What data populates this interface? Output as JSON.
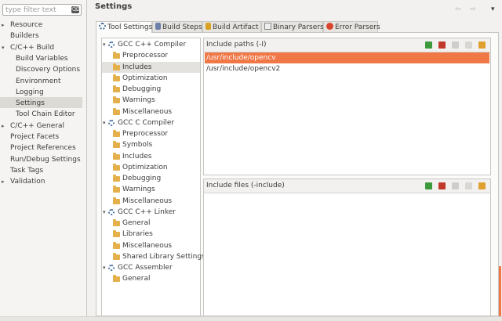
{
  "filter": {
    "placeholder": "type filter text",
    "clear_glyph": "⌫"
  },
  "nav": {
    "items": [
      {
        "label": "Resource",
        "expander": "▸"
      },
      {
        "label": "Builders",
        "expander": ""
      },
      {
        "label": "C/C++ Build",
        "expander": "▾"
      },
      {
        "label": "Build Variables",
        "expander": ""
      },
      {
        "label": "Discovery Options",
        "expander": ""
      },
      {
        "label": "Environment",
        "expander": ""
      },
      {
        "label": "Logging",
        "expander": ""
      },
      {
        "label": "Settings",
        "expander": ""
      },
      {
        "label": "Tool Chain Editor",
        "expander": ""
      },
      {
        "label": "C/C++ General",
        "expander": "▸"
      },
      {
        "label": "Project Facets",
        "expander": ""
      },
      {
        "label": "Project References",
        "expander": ""
      },
      {
        "label": "Run/Debug Settings",
        "expander": ""
      },
      {
        "label": "Task Tags",
        "expander": ""
      },
      {
        "label": "Validation",
        "expander": "▸"
      }
    ],
    "selected": "Settings"
  },
  "page": {
    "title": "Settings",
    "history": {
      "back": "⇦",
      "forward": "⇨",
      "menu": "▾"
    }
  },
  "tabs": [
    {
      "label": "Tool Settings",
      "icon": "gear-icon",
      "active": true
    },
    {
      "label": "Build Steps",
      "icon": "wrench-icon",
      "active": false
    },
    {
      "label": "Build Artifact",
      "icon": "trophy-icon",
      "active": false
    },
    {
      "label": "Binary Parsers",
      "icon": "binary-icon",
      "active": false
    },
    {
      "label": "Error Parsers",
      "icon": "error-icon",
      "active": false
    }
  ],
  "tool_tree": [
    {
      "label": "GCC C++ Compiler",
      "type": "tool",
      "expander": "▾"
    },
    {
      "label": "Preprocessor",
      "type": "option"
    },
    {
      "label": "Includes",
      "type": "option"
    },
    {
      "label": "Optimization",
      "type": "option"
    },
    {
      "label": "Debugging",
      "type": "option"
    },
    {
      "label": "Warnings",
      "type": "option"
    },
    {
      "label": "Miscellaneous",
      "type": "option"
    },
    {
      "label": "GCC C Compiler",
      "type": "tool",
      "expander": "▾"
    },
    {
      "label": "Preprocessor",
      "type": "option"
    },
    {
      "label": "Symbols",
      "type": "option"
    },
    {
      "label": "Includes",
      "type": "option"
    },
    {
      "label": "Optimization",
      "type": "option"
    },
    {
      "label": "Debugging",
      "type": "option"
    },
    {
      "label": "Warnings",
      "type": "option"
    },
    {
      "label": "Miscellaneous",
      "type": "option"
    },
    {
      "label": "GCC C++ Linker",
      "type": "tool",
      "expander": "▾"
    },
    {
      "label": "General",
      "type": "option"
    },
    {
      "label": "Libraries",
      "type": "option"
    },
    {
      "label": "Miscellaneous",
      "type": "option"
    },
    {
      "label": "Shared Library Settings",
      "type": "option"
    },
    {
      "label": "GCC Assembler",
      "type": "tool",
      "expander": "▾"
    },
    {
      "label": "General",
      "type": "option"
    }
  ],
  "include_paths": {
    "title": "Include paths (-I)",
    "items": [
      "/usr/include/opencv",
      "/usr/include/opencv2"
    ],
    "selected_index": 0,
    "actions": [
      "add-icon",
      "delete-icon",
      "edit-icon",
      "move-up-icon",
      "move-down-icon"
    ]
  },
  "include_files": {
    "title": "Include files (-include)",
    "items": [],
    "actions": [
      "add-icon",
      "delete-icon",
      "edit-icon",
      "move-up-icon",
      "move-down-icon"
    ]
  },
  "colors": {
    "selection": "#f07746",
    "panel_bg": "#f2f1f0",
    "gear": "#4a6fa0",
    "folder": "#e3b04b",
    "add": "#3c9a3c",
    "delete": "#c0392b"
  }
}
